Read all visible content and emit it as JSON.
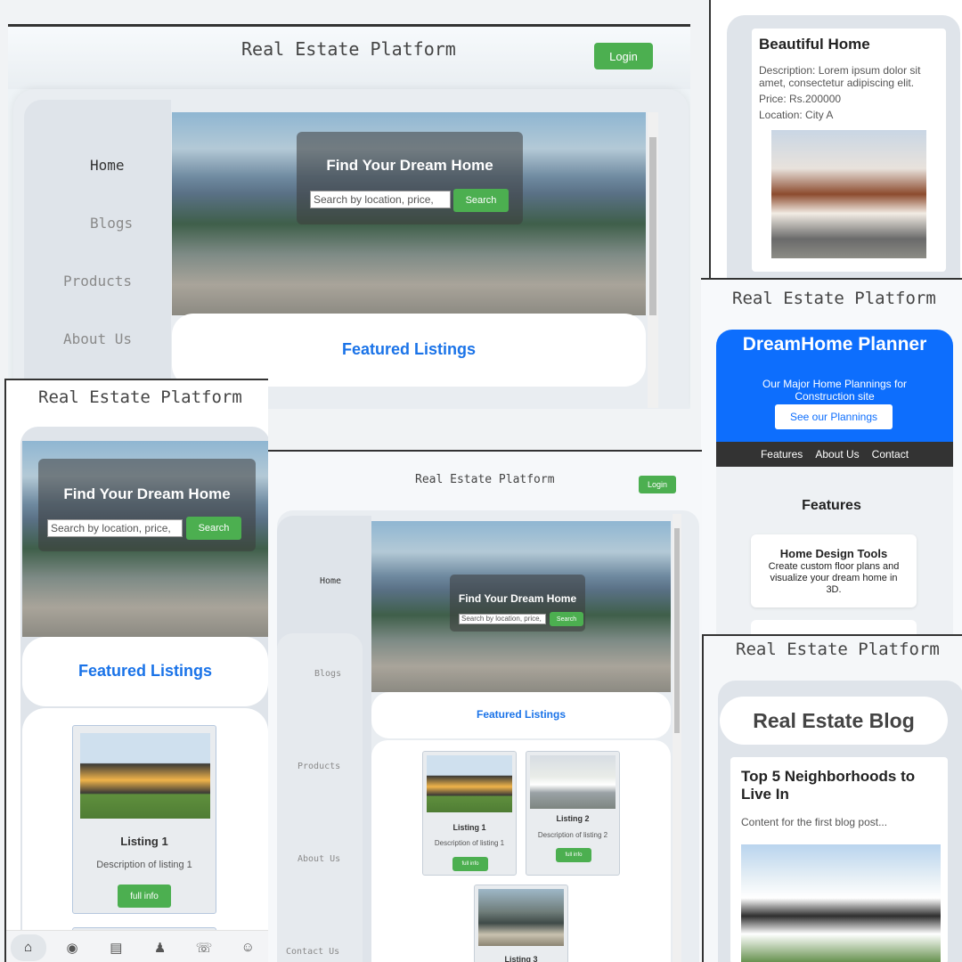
{
  "site_title": "Real Estate Platform",
  "login_label": "Login",
  "nav": {
    "home": "Home",
    "blogs": "Blogs",
    "products": "Products",
    "about": "About Us",
    "contact": "Contact Us"
  },
  "hero": {
    "title": "Find Your Dream Home",
    "search_placeholder": "Search by location, price,",
    "search_button": "Search"
  },
  "featured_title": "Featured Listings",
  "listings": [
    {
      "title": "Listing 1",
      "description": "Description of listing 1",
      "button": "full info"
    },
    {
      "title": "Listing 2",
      "description": "Description of listing 2",
      "button": "full info"
    },
    {
      "title": "Listing 3"
    }
  ],
  "property_detail": {
    "title": "Beautiful Home",
    "description": "Description: Lorem ipsum dolor sit amet, consectetur adipiscing elit.",
    "price": "Price: Rs.200000",
    "location": "Location: City A"
  },
  "planner": {
    "title": "DreamHome Planner",
    "subtitle": "Our Major Home Plannings for Construction site",
    "button": "See our Plannings",
    "nav": [
      "Features",
      "About Us",
      "Contact"
    ],
    "features_heading": "Features",
    "feature_card": {
      "title": "Home Design Tools",
      "text": "Create custom floor plans and visualize your dream home in 3D."
    }
  },
  "blog": {
    "heading": "Real Estate Blog",
    "post_title": "Top 5 Neighborhoods to Live In",
    "post_excerpt": "Content for the first blog post..."
  },
  "mobile_tabs": [
    "home-icon",
    "blog-icon",
    "products-icon",
    "about-icon",
    "contact-icon",
    "user-icon"
  ],
  "colors": {
    "accent_green": "#4caf50",
    "accent_blue": "#1a73e8",
    "planner_blue": "#0d6efd"
  }
}
